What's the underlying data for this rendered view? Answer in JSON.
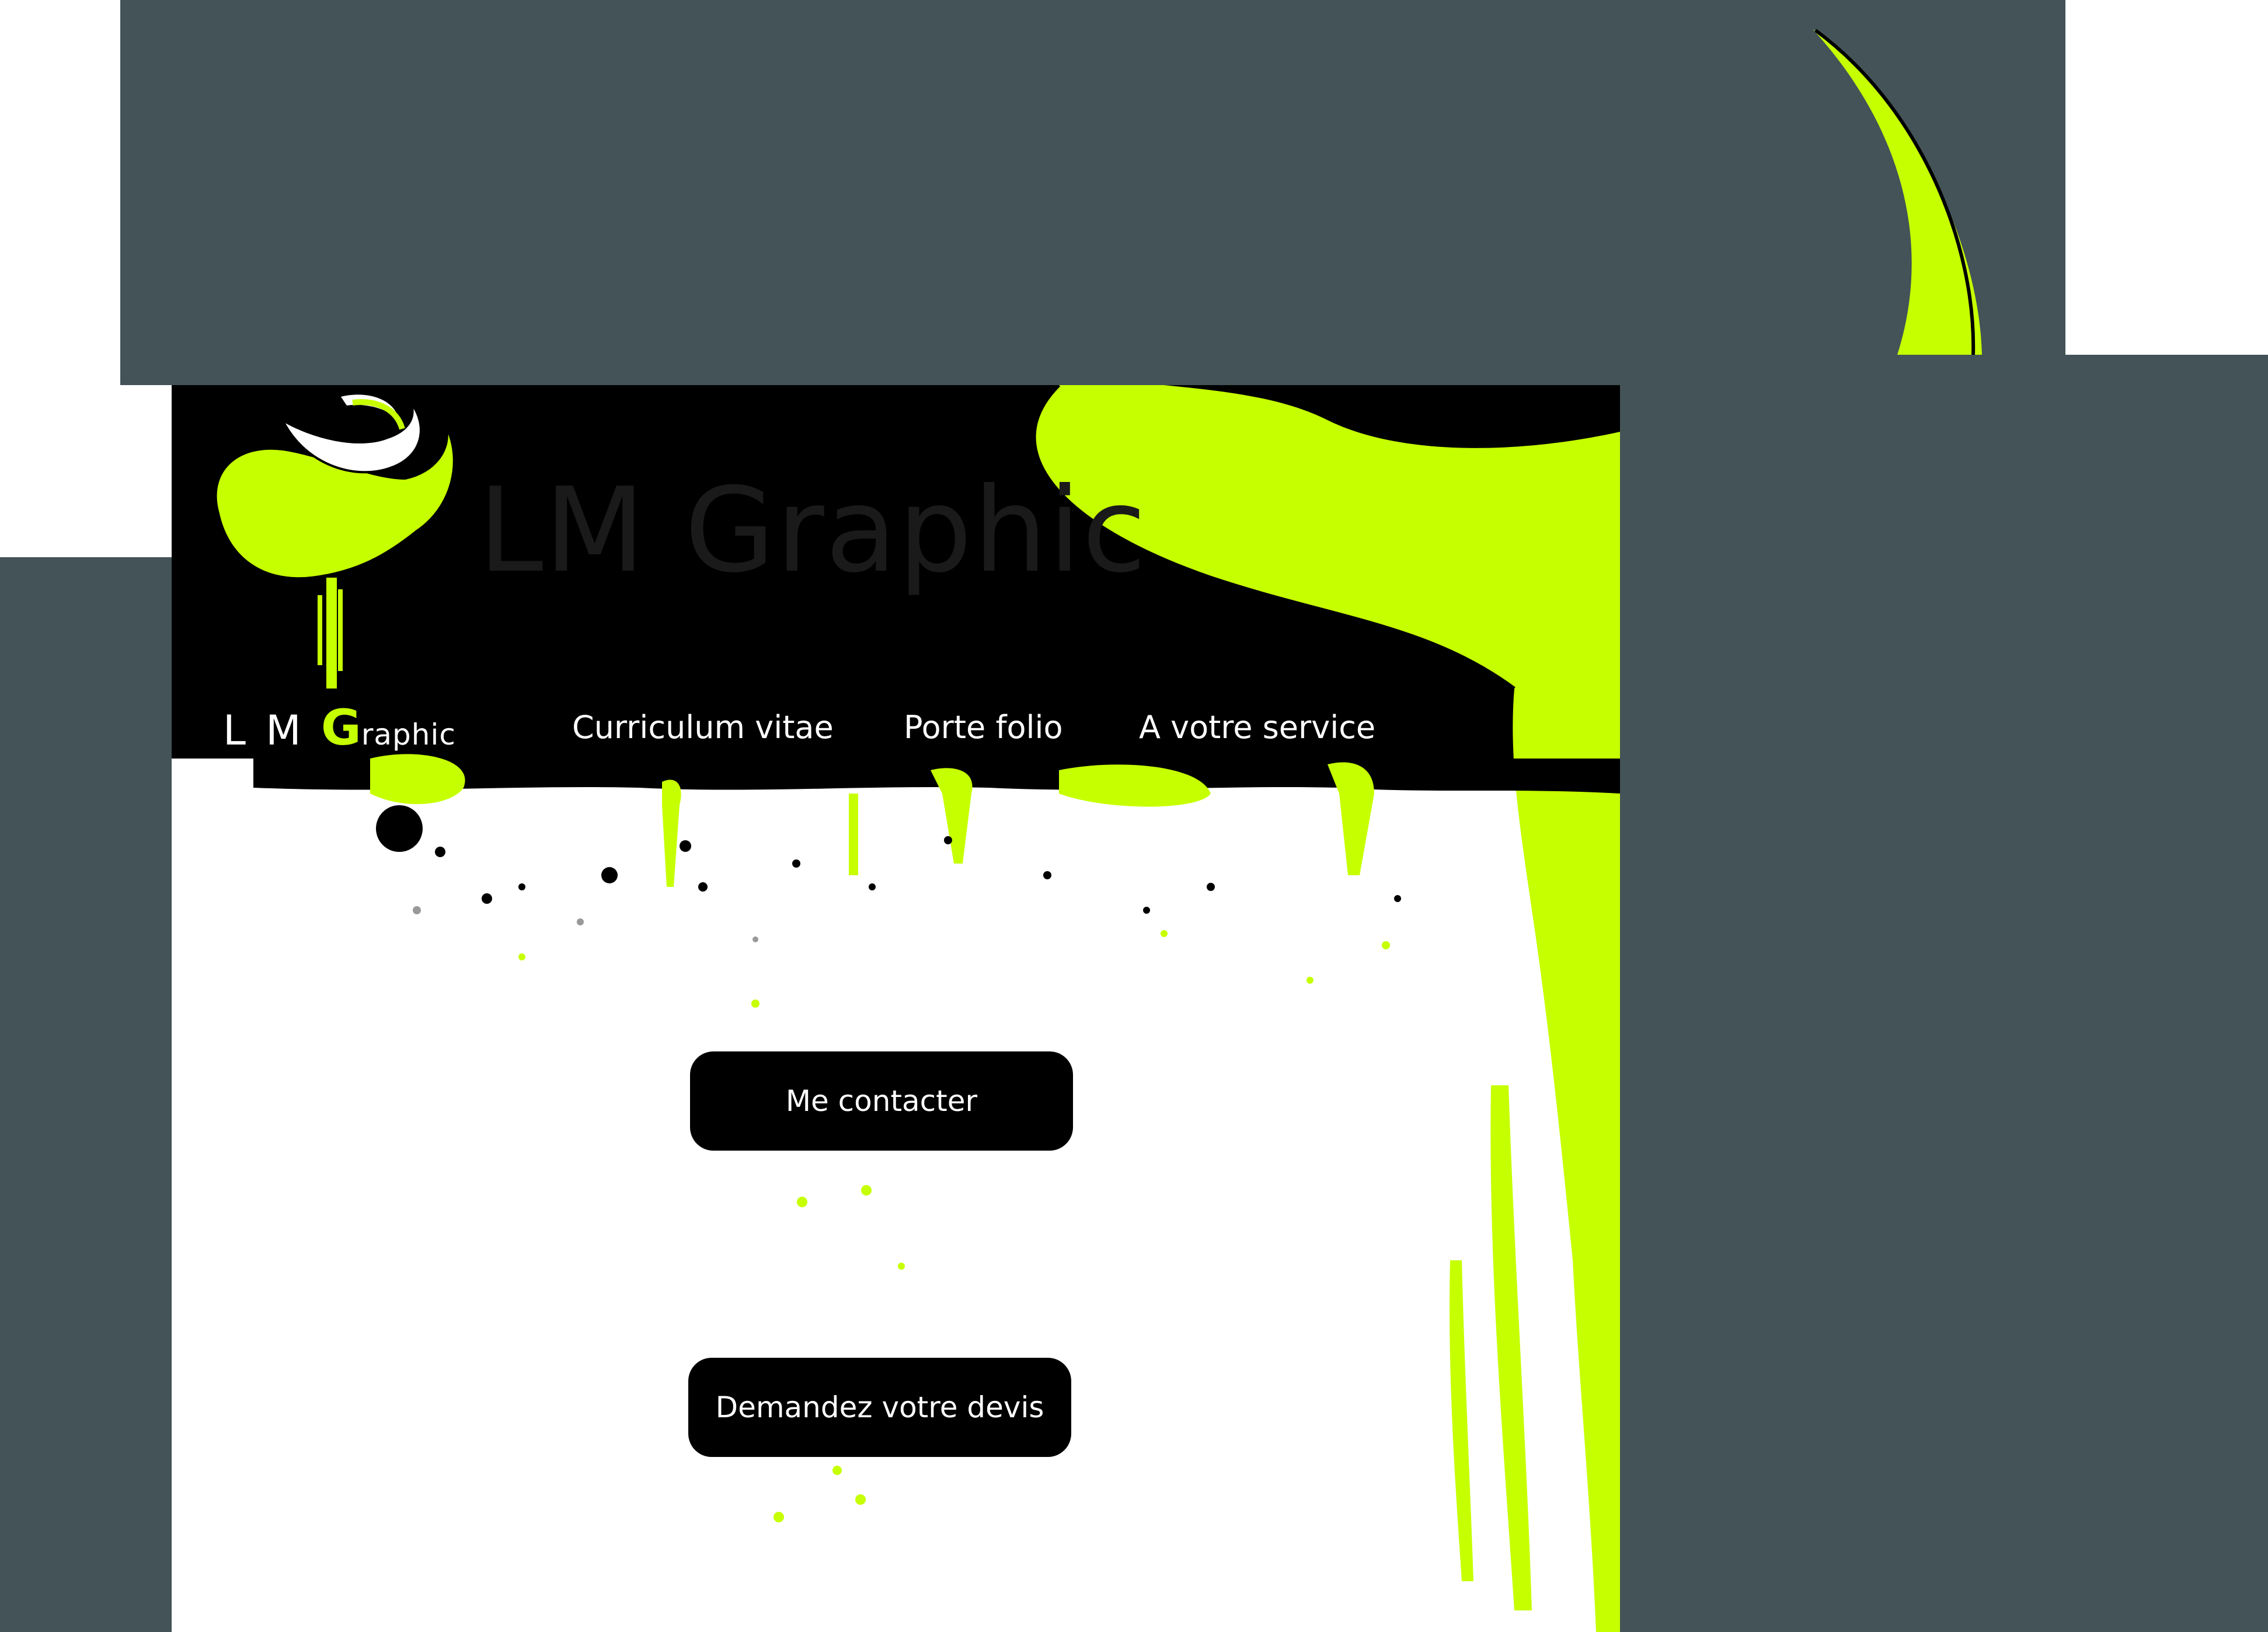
{
  "brand": {
    "watermark_title": "LM Graphic",
    "logo_lm": "L M ",
    "logo_g": "G",
    "logo_rest": "raphic"
  },
  "nav": {
    "items": [
      {
        "label": "Curriculum vitae"
      },
      {
        "label": "Porte folio"
      },
      {
        "label": "A votre service"
      }
    ]
  },
  "actions": {
    "contact_label": "Me contacter",
    "quote_label": "Demandez votre devis"
  },
  "colors": {
    "accent": "#c6ff00",
    "background_slate": "#435357",
    "header": "#000000",
    "panel": "#ffffff"
  },
  "icons": {
    "logo": "paint-swirl-logo-icon",
    "decoration": "paint-splash-decoration"
  }
}
